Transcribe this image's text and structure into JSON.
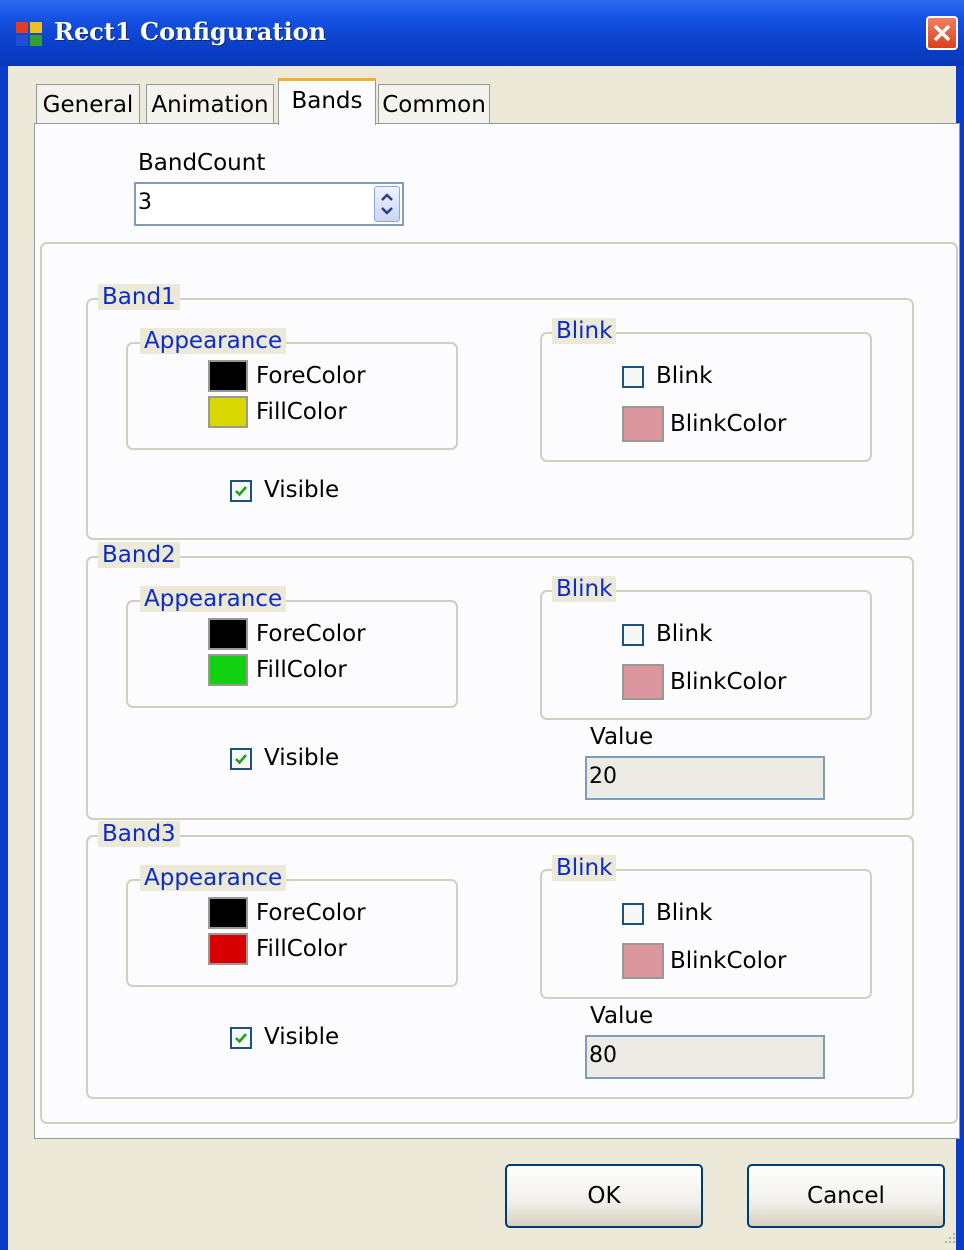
{
  "window": {
    "title": "Rect1 Configuration"
  },
  "tabs": [
    {
      "label": "General",
      "active": false
    },
    {
      "label": "Animation",
      "active": false
    },
    {
      "label": "Bands",
      "active": true
    },
    {
      "label": "Common",
      "active": false
    }
  ],
  "band_count": {
    "label": "BandCount",
    "value": "3"
  },
  "bands": [
    {
      "title": "Band1",
      "appearance_title": "Appearance",
      "fore_color_label": "ForeColor",
      "fore_color": "#000000",
      "fill_color_label": "FillColor",
      "fill_color": "#d8d800",
      "blink_title": "Blink",
      "blink_label": "Blink",
      "blink_checked": false,
      "blink_color_label": "BlinkColor",
      "blink_color": "#dc96a0",
      "visible_label": "Visible",
      "visible_checked": true
    },
    {
      "title": "Band2",
      "appearance_title": "Appearance",
      "fore_color_label": "ForeColor",
      "fore_color": "#000000",
      "fill_color_label": "FillColor",
      "fill_color": "#10d010",
      "blink_title": "Blink",
      "blink_label": "Blink",
      "blink_checked": false,
      "blink_color_label": "BlinkColor",
      "blink_color": "#dc96a0",
      "visible_label": "Visible",
      "visible_checked": true,
      "value_label": "Value",
      "value": "20"
    },
    {
      "title": "Band3",
      "appearance_title": "Appearance",
      "fore_color_label": "ForeColor",
      "fore_color": "#000000",
      "fill_color_label": "FillColor",
      "fill_color": "#d80000",
      "blink_title": "Blink",
      "blink_label": "Blink",
      "blink_checked": false,
      "blink_color_label": "BlinkColor",
      "blink_color": "#dc96a0",
      "visible_label": "Visible",
      "visible_checked": true,
      "value_label": "Value",
      "value": "80"
    }
  ],
  "buttons": {
    "ok": "OK",
    "cancel": "Cancel"
  },
  "colors": {
    "title_bar": "#0a3fc8",
    "legend_text": "#0b2cc8",
    "dialog_bg": "#ece9d8",
    "active_tab_accent": "#f0b030"
  }
}
